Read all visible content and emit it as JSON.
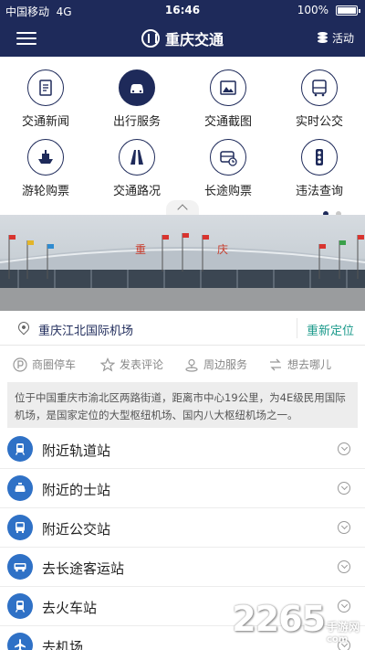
{
  "status_bar": {
    "carrier": "中国移动",
    "network": "4G",
    "time": "16:46",
    "battery": "100%",
    "battery_level": 1.0
  },
  "header": {
    "title": "重庆交通",
    "activity_label": "活动"
  },
  "services": [
    {
      "label": "交通新闻",
      "icon": "news-icon"
    },
    {
      "label": "出行服务",
      "icon": "car-icon"
    },
    {
      "label": "交通截图",
      "icon": "picture-icon"
    },
    {
      "label": "实时公交",
      "icon": "bus-icon"
    },
    {
      "label": "游轮购票",
      "icon": "ship-icon"
    },
    {
      "label": "交通路况",
      "icon": "road-icon"
    },
    {
      "label": "长途购票",
      "icon": "coach-icon"
    },
    {
      "label": "违法查询",
      "icon": "traffic-light-icon"
    }
  ],
  "banner": {
    "sign_chars": [
      "重",
      "庆"
    ]
  },
  "location": {
    "name": "重庆江北国际机场",
    "relocate_label": "重新定位"
  },
  "actions": [
    {
      "label": "商圈停车",
      "icon": "parking-icon"
    },
    {
      "label": "发表评论",
      "icon": "star-icon"
    },
    {
      "label": "周边服务",
      "icon": "location-person-icon"
    },
    {
      "label": "想去哪儿",
      "icon": "swap-arrows-icon"
    }
  ],
  "description": "位于中国重庆市渝北区两路街道，距离市中心19公里，为4E级民用国际机场，是国家定位的大型枢纽机场、国内八大枢纽机场之一。",
  "nearby": [
    {
      "label": "附近轨道站",
      "icon": "train-icon"
    },
    {
      "label": "附近的士站",
      "icon": "taxi-icon"
    },
    {
      "label": "附近公交站",
      "icon": "bus-icon"
    },
    {
      "label": "去长途客运站",
      "icon": "coach-icon"
    },
    {
      "label": "去火车站",
      "icon": "train-icon"
    },
    {
      "label": "去机场",
      "icon": "plane-icon"
    }
  ],
  "watermark": {
    "big": "2265",
    "small": "手游网",
    "domain": "com"
  },
  "colors": {
    "header": "#1e2a5a",
    "accent_green": "#1b9a8b",
    "list_icon_blue": "#2f71c6"
  }
}
